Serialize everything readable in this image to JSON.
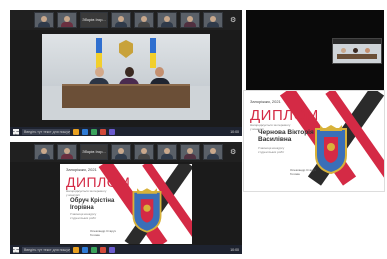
{
  "top_left_screen": {
    "participant_names": [
      "Зборів Ігор...",
      "Зборів Ігор..."
    ],
    "taskbar_search": "Введіть тут текст для пошуку",
    "clock": "10:00"
  },
  "bottom_left_screen": {
    "participant_names": [
      "Зборів Ігор..."
    ],
    "taskbar_search": "Введіть тут текст для пошуку",
    "clock": "10:00"
  },
  "diploma_left": {
    "date": "Запоріжжя, 2021",
    "title": "ДИПЛОМ",
    "subtitle": "Нагороджується за перемогу\nу конкурсі",
    "recipient": "Обруч Крістіна\nІгорівна",
    "description": "Учасниця конкурсу\nстудентських робіт",
    "signer": "Олександр Старух\nГолова"
  },
  "diploma_right": {
    "date": "Запоріжжя, 2021",
    "title": "ДИПЛОМ",
    "subtitle": "Нагороджується за перемогу\nу конкурсі",
    "recipient": "Чернова Вікторія\nВасилівна",
    "description": "Учасниця конкурсу\nстудентських робіт",
    "signer": "Олександр Старух\nГолова"
  },
  "colors": {
    "diploma_red": "#d42a45",
    "diploma_dark": "#2b2b2b",
    "coat_blue": "#3a6fb8",
    "coat_gold": "#d8b23a"
  }
}
